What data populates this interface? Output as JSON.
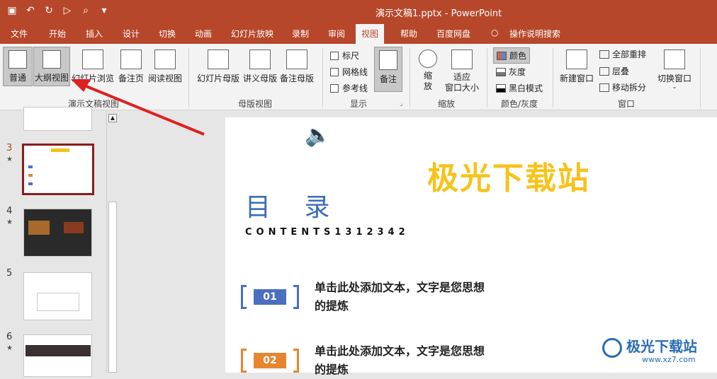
{
  "titlebar": {
    "title": "演示文稿1.pptx  -  PowerPoint",
    "qat_icons": [
      "save-icon",
      "undo-icon",
      "redo-icon",
      "slideshow-from-beginning-icon",
      "print-preview-icon",
      "customize-qat-icon"
    ]
  },
  "tabs": [
    "文件",
    "开始",
    "插入",
    "设计",
    "切换",
    "动画",
    "幻灯片放映",
    "录制",
    "审阅",
    "视图",
    "帮助",
    "百度网盘",
    "操作说明搜索"
  ],
  "ribbon": {
    "presentation_views": {
      "normal": "普通",
      "outline": "大纲视图",
      "slide_sorter": "幻灯片浏览",
      "notes_page": "备注页",
      "reading_view": "阅读视图",
      "label": "演示文稿视图"
    },
    "master_views": {
      "slide_master": "幻灯片母版",
      "handout_master": "讲义母版",
      "notes_master": "备注母版",
      "label": "母版视图"
    },
    "show": {
      "ruler": "标尺",
      "gridlines": "网格线",
      "guides": "参考线",
      "notes": "备注",
      "label": "显示"
    },
    "zoom": {
      "zoom": "缩\n放",
      "fit": "适应\n窗口大小",
      "label": "缩放"
    },
    "color": {
      "color": "颜色",
      "grayscale": "灰度",
      "bw": "黑白模式",
      "label": "颜色/灰度"
    },
    "window": {
      "new_window": "新建窗口",
      "arrange_all": "全部重排",
      "cascade": "层叠",
      "move_split": "移动拆分",
      "switch_windows": "切换窗口",
      "label": "窗口"
    }
  },
  "thumbs": [
    {
      "num": "",
      "star": false
    },
    {
      "num": "3",
      "star": true
    },
    {
      "num": "4",
      "star": true
    },
    {
      "num": "5",
      "star": false
    },
    {
      "num": "6",
      "star": true
    }
  ],
  "slide": {
    "watermark_title": "极光下载站",
    "heading": "目 录",
    "subheading": "CONTENTS1312342",
    "items": [
      {
        "num": "01",
        "text": "单击此处添加文本，文字是您思想的提炼"
      },
      {
        "num": "02",
        "text": "单击此处添加文本，文字是您思想的提炼"
      }
    ]
  },
  "watermark": {
    "brand": "极光下载站",
    "url": "www.xz7.com"
  },
  "colors": {
    "accent": "#b7472a",
    "blue": "#4a6fbf",
    "orange": "#e8852f",
    "gold": "#f6c31b"
  }
}
